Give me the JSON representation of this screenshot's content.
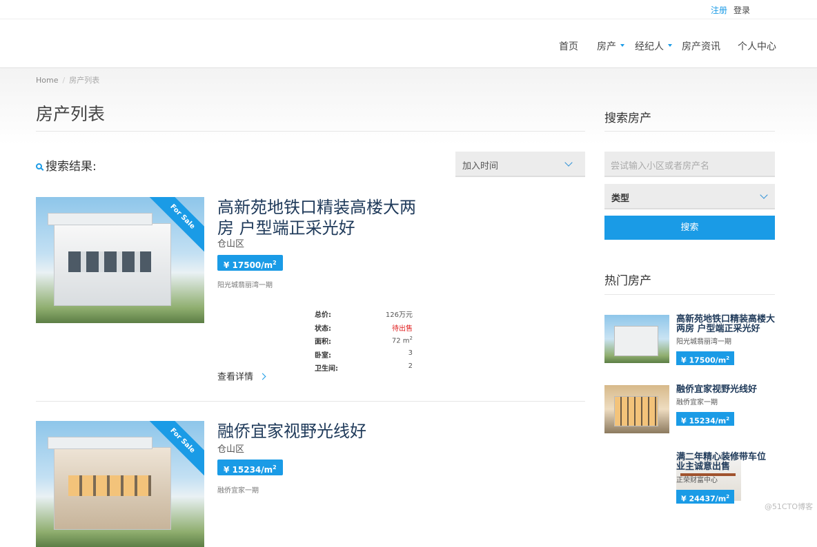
{
  "topbar": {
    "register": "注册",
    "login": "登录"
  },
  "nav": [
    {
      "label": "首页",
      "dropdown": false
    },
    {
      "label": "房产",
      "dropdown": true
    },
    {
      "label": "经纪人",
      "dropdown": true
    },
    {
      "label": "房产资讯",
      "dropdown": false
    },
    {
      "label": "个人中心",
      "dropdown": false
    }
  ],
  "breadcrumb": {
    "home": "Home",
    "current": "房产列表"
  },
  "page_title": "房产列表",
  "results_label": "搜索结果:",
  "sort": {
    "selected": "加入时间"
  },
  "listings": [
    {
      "ribbon": "For Sale",
      "title": "高新苑地铁口精装高楼大两房 户型端正采光好",
      "district": "仓山区",
      "price": "¥ 17500/m",
      "price_sup": "2",
      "community": "阳光城翡丽湾一期",
      "specs": [
        {
          "k": "总价:",
          "v": "126万元",
          "color": "#333"
        },
        {
          "k": "状态:",
          "v": "待出售",
          "color": "#e02020"
        },
        {
          "k": "面积:",
          "v": "72 m",
          "sup": "2",
          "color": "#333"
        },
        {
          "k": "卧室:",
          "v": "3",
          "color": "#333"
        },
        {
          "k": "卫生间:",
          "v": "2",
          "color": "#333"
        }
      ],
      "detail": "查看详情"
    },
    {
      "ribbon": "For Sale",
      "title": "融侨宜家视野光线好",
      "district": "仓山区",
      "price": "¥ 15234/m",
      "price_sup": "2",
      "community": "融侨宜家一期"
    }
  ],
  "sidebar": {
    "search_title": "搜索房产",
    "search_placeholder": "尝试输入小区或者房产名",
    "type_label": "类型",
    "search_button": "搜索",
    "hot_title": "热门房产",
    "hot": [
      {
        "title": "高新苑地铁口精装高楼大两房 户型端正采光好",
        "community": "阳光城翡丽湾一期",
        "price": "¥ 17500/m",
        "sup": "2"
      },
      {
        "title": "融侨宜家视野光线好",
        "community": "融侨宜家一期",
        "price": "¥ 15234/m",
        "sup": "2"
      },
      {
        "title": "满二年精心装修带车位 业主诚意出售",
        "community": "正荣财富中心",
        "price": "¥ 24437/m",
        "sup": "2"
      }
    ]
  },
  "watermark": "@51CTO博客",
  "colors": {
    "accent": "#1a9be6",
    "title": "#1f3a5a",
    "status": "#e02020"
  }
}
